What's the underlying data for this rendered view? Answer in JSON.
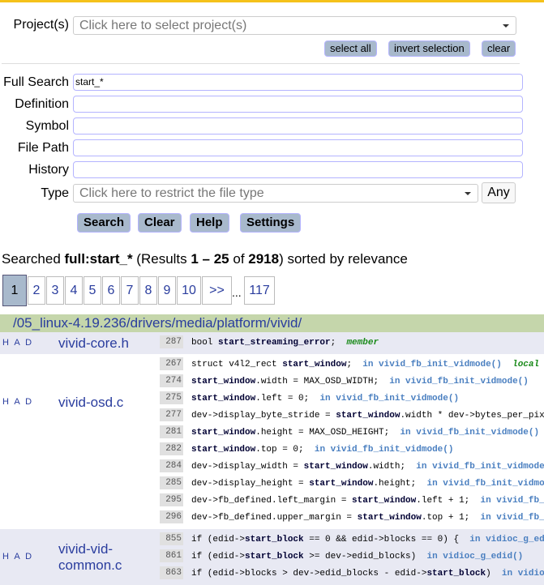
{
  "form": {
    "project_label": "Project(s)",
    "project_placeholder": "Click here to select project(s)",
    "select_all": "select all",
    "invert_selection": "invert selection",
    "clear_small": "clear",
    "full_search_label": "Full Search",
    "full_search_value": "start_*",
    "definition_label": "Definition",
    "symbol_label": "Symbol",
    "file_path_label": "File Path",
    "history_label": "History",
    "type_label": "Type",
    "type_placeholder": "Click here to restrict the file type",
    "any_label": "Any",
    "search": "Search",
    "clear": "Clear",
    "help": "Help",
    "settings": "Settings"
  },
  "summary": {
    "prefix": "Searched ",
    "query": "full:start_*",
    "mid1": " (Results ",
    "range": "1 – 25",
    "mid2": " of ",
    "total": "2918",
    "suffix": ") sorted by relevance"
  },
  "pagination": {
    "pages": [
      "1",
      "2",
      "3",
      "4",
      "5",
      "6",
      "7",
      "8",
      "9",
      "10",
      ">>"
    ],
    "ellipsis": "...",
    "last": "117",
    "current": "1"
  },
  "directory": "/05_linux-4.19.236/drivers/media/platform/vivid/",
  "colors": {
    "accent": "#f5c21b",
    "dir_bar": "#c5d6ab",
    "button": "#a8b9cc",
    "link": "#2a3d9e",
    "alt_row": "#e8e9f3"
  },
  "results": [
    {
      "had": "H A D",
      "file": "vivid-core.h",
      "lines": [
        {
          "n": "287",
          "parts": [
            [
              "bool ",
              ""
            ],
            [
              "start_streaming_error",
              "b"
            ],
            [
              ";  ",
              ""
            ],
            [
              "member",
              "tag"
            ]
          ]
        }
      ]
    },
    {
      "had": "H A D",
      "file": "vivid-osd.c",
      "lines": [
        {
          "n": "267",
          "parts": [
            [
              "struct v4l2_rect ",
              ""
            ],
            [
              "start_window",
              "b"
            ],
            [
              ";  ",
              ""
            ],
            [
              "in vivid_fb_init_vidmode()",
              "fn"
            ],
            [
              "  ",
              ""
            ],
            [
              "local",
              "tag"
            ]
          ]
        },
        {
          "n": "274",
          "parts": [
            [
              "start_window",
              "b"
            ],
            [
              ".width = MAX_OSD_WIDTH;  ",
              ""
            ],
            [
              "in vivid_fb_init_vidmode()",
              "fn"
            ]
          ]
        },
        {
          "n": "275",
          "parts": [
            [
              "start_window",
              "b"
            ],
            [
              ".left = 0;  ",
              ""
            ],
            [
              "in vivid_fb_init_vidmode()",
              "fn"
            ]
          ]
        },
        {
          "n": "277",
          "parts": [
            [
              "dev->display_byte_stride = ",
              ""
            ],
            [
              "start_window",
              "b"
            ],
            [
              ".width * dev->bytes_per_pixel;",
              ""
            ]
          ]
        },
        {
          "n": "281",
          "parts": [
            [
              "start_window",
              "b"
            ],
            [
              ".height = MAX_OSD_HEIGHT;  ",
              ""
            ],
            [
              "in vivid_fb_init_vidmode()",
              "fn"
            ]
          ]
        },
        {
          "n": "282",
          "parts": [
            [
              "start_window",
              "b"
            ],
            [
              ".top = 0;  ",
              ""
            ],
            [
              "in vivid_fb_init_vidmode()",
              "fn"
            ]
          ]
        },
        {
          "n": "284",
          "parts": [
            [
              "dev->display_width = ",
              ""
            ],
            [
              "start_window",
              "b"
            ],
            [
              ".width;  ",
              ""
            ],
            [
              "in vivid_fb_init_vidmode()",
              "fn"
            ]
          ]
        },
        {
          "n": "285",
          "parts": [
            [
              "dev->display_height = ",
              ""
            ],
            [
              "start_window",
              "b"
            ],
            [
              ".height;  ",
              ""
            ],
            [
              "in vivid_fb_init_vidmode()",
              "fn"
            ]
          ]
        },
        {
          "n": "295",
          "parts": [
            [
              "dev->fb_defined.left_margin = ",
              ""
            ],
            [
              "start_window",
              "b"
            ],
            [
              ".left + 1;  ",
              ""
            ],
            [
              "in vivid_fb_init_vidmode()",
              "fn"
            ]
          ]
        },
        {
          "n": "296",
          "parts": [
            [
              "dev->fb_defined.upper_margin = ",
              ""
            ],
            [
              "start_window",
              "b"
            ],
            [
              ".top + 1;  ",
              ""
            ],
            [
              "in vivid_fb_init_vidmode()",
              "fn"
            ]
          ]
        }
      ]
    },
    {
      "had": "H A D",
      "file": "vivid-vid-common.c",
      "lines": [
        {
          "n": "855",
          "parts": [
            [
              "if (edid->",
              ""
            ],
            [
              "start_block",
              "b"
            ],
            [
              " == 0 && edid->blocks == 0) {  ",
              ""
            ],
            [
              "in vidioc_g_edid()",
              "fn"
            ]
          ]
        },
        {
          "n": "861",
          "parts": [
            [
              "if (edid->",
              ""
            ],
            [
              "start_block",
              "b"
            ],
            [
              " >= dev->edid_blocks)  ",
              ""
            ],
            [
              "in vidioc_g_edid()",
              "fn"
            ]
          ]
        },
        {
          "n": "863",
          "parts": [
            [
              "if (edid->blocks > dev->edid_blocks - edid->",
              ""
            ],
            [
              "start_block",
              "b"
            ],
            [
              ")  ",
              ""
            ],
            [
              "in vidioc_g_edid()",
              "fn"
            ]
          ]
        }
      ]
    }
  ]
}
